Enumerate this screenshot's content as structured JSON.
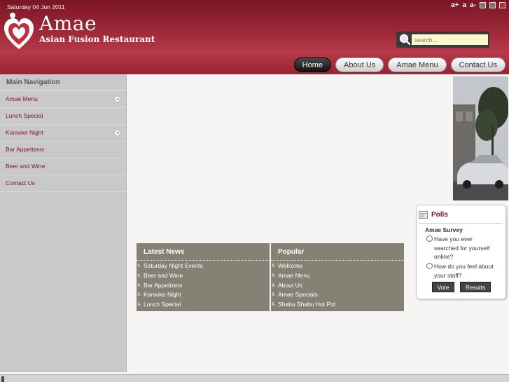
{
  "header": {
    "date": "Saturday 04 Jun 2011",
    "logo_title": "Amae",
    "logo_subtitle": "Asian Fusion Restaurant",
    "font_controls": [
      "a+",
      "a",
      "a-"
    ]
  },
  "search": {
    "placeholder": "search..."
  },
  "topnav": {
    "items": [
      {
        "label": "Home"
      },
      {
        "label": "About Us"
      },
      {
        "label": "Amae Menu"
      },
      {
        "label": "Contact Us"
      }
    ]
  },
  "sidebar": {
    "title": "Main Navigation",
    "items": [
      {
        "label": "Amae Menu"
      },
      {
        "label": "Lunch Special"
      },
      {
        "label": "Karaoke Night"
      },
      {
        "label": "Bar Appetizers"
      },
      {
        "label": "Beer and Wine"
      },
      {
        "label": "Contact Us"
      }
    ]
  },
  "latest_news": {
    "title": "Latest News",
    "items": [
      "Saturday Night Events",
      "Beer and Wine",
      "Bar Appetizers",
      "Karaoke Night",
      "Lunch Special"
    ]
  },
  "popular": {
    "title": "Popular",
    "items": [
      "Welcome",
      "Amae Menu",
      "About Us",
      "Amae Specials",
      "Shabu Shabu Hot Pot"
    ]
  },
  "polls": {
    "title": "Polls",
    "survey_title": "Amae Survey",
    "options": [
      {
        "label": "Have you ever searched for yourself online?"
      },
      {
        "label": "How do you feel about your staff?"
      }
    ],
    "vote_label": "Vote",
    "results_label": "Results"
  },
  "colors": {
    "header": "#a02a3a",
    "accent": "#7a1524",
    "box": "#868175",
    "sidebar": "#c9c9c9"
  }
}
